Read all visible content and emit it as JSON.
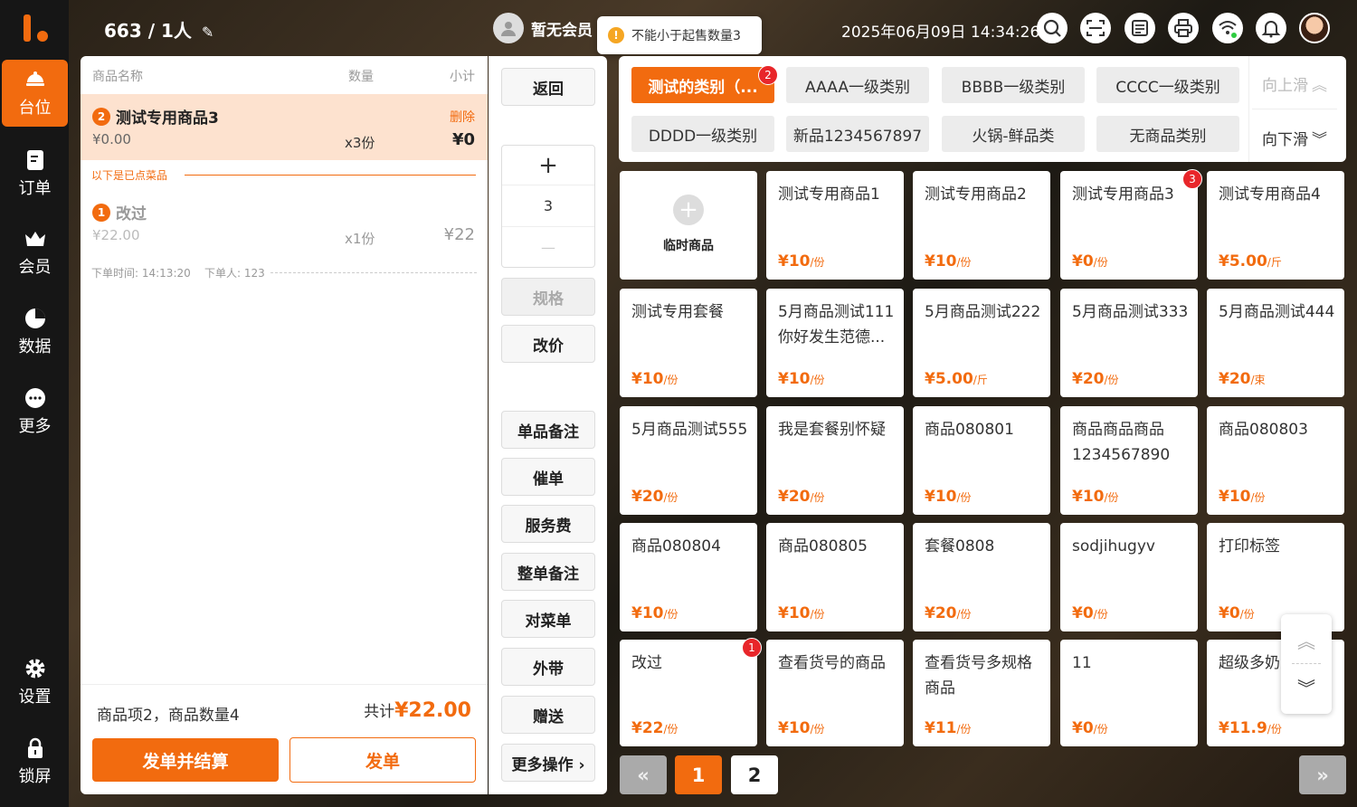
{
  "colors": {
    "accent": "#f26b0f",
    "badge": "#e8262a",
    "sidebar": "#161616"
  },
  "nav": [
    {
      "label": "台位",
      "icon": "dining-table-icon",
      "active": true
    },
    {
      "label": "订单",
      "icon": "order-icon"
    },
    {
      "label": "会员",
      "icon": "member-crown-icon"
    },
    {
      "label": "数据",
      "icon": "pie-chart-icon"
    },
    {
      "label": "更多",
      "icon": "more-dots-icon"
    },
    {
      "label": "设置",
      "icon": "gear-icon"
    },
    {
      "label": "锁屏",
      "icon": "lock-icon"
    }
  ],
  "topbar": {
    "table_info": "663 / 1人",
    "member": "暂无会员",
    "toast": "不能小于起售数量3",
    "datetime": "2025年06月09日 14:34:26",
    "icons": [
      "search-icon",
      "scan-icon",
      "receipt-icon",
      "printer-icon",
      "wifi-icon",
      "bell-icon"
    ]
  },
  "order": {
    "headers": {
      "name": "商品名称",
      "qty": "数量",
      "subtotal": "小计"
    },
    "current": {
      "index": "2",
      "name": "测试专用商品3",
      "delete": "删除",
      "price": "¥0.00",
      "qty": "x3份",
      "subtotal": "¥0"
    },
    "ordered_label": "以下是已点菜品",
    "ordered": {
      "index": "1",
      "name": "改过",
      "price": "¥22.00",
      "qty": "x1份",
      "subtotal": "¥22"
    },
    "meta": "下单时间: 14:13:20    下单人: 123",
    "summary": "商品项2，商品数量4",
    "total_label": "共计",
    "total_value": "¥22.00",
    "settle_btn": "发单并结算",
    "send_btn": "发单"
  },
  "actions": {
    "back": "返回",
    "plus": "+",
    "qty": "3",
    "minus": "—",
    "spec": "规格",
    "change_price": "改价",
    "item_note": "单品备注",
    "urge": "催单",
    "service_fee": "服务费",
    "order_note": "整单备注",
    "check_menu": "对菜单",
    "takeout": "外带",
    "gift": "赠送",
    "more": "更多操作 ›"
  },
  "categories": {
    "items": [
      {
        "label": "测试的类别（...",
        "active": true,
        "badge": "2"
      },
      {
        "label": "AAAA一级类别"
      },
      {
        "label": "BBBB一级类别"
      },
      {
        "label": "CCCC一级类别"
      },
      {
        "label": "DDDD一级类别"
      },
      {
        "label": "新品1234567897"
      },
      {
        "label": "火锅-鲜品类"
      },
      {
        "label": "无商品类别"
      }
    ],
    "scroll_up": "向上滑",
    "scroll_down": "向下滑"
  },
  "temp_product": "临时商品",
  "products": [
    {
      "name": "测试专用商品1",
      "price": "¥10",
      "unit": "/份"
    },
    {
      "name": "测试专用商品2",
      "price": "¥10",
      "unit": "/份"
    },
    {
      "name": "测试专用商品3",
      "price": "¥0",
      "unit": "/份",
      "badge": "3"
    },
    {
      "name": "测试专用商品4",
      "price": "¥5.00",
      "unit": "/斤"
    },
    {
      "name": "测试专用套餐",
      "price": "¥10",
      "unit": "/份"
    },
    {
      "name": "5月商品测试111你好发生范德...",
      "price": "¥10",
      "unit": "/份"
    },
    {
      "name": "5月商品测试222",
      "price": "¥5.00",
      "unit": "/斤"
    },
    {
      "name": "5月商品测试333",
      "price": "¥20",
      "unit": "/份"
    },
    {
      "name": "5月商品测试444",
      "price": "¥20",
      "unit": "/束"
    },
    {
      "name": "5月商品测试555",
      "price": "¥20",
      "unit": "/份"
    },
    {
      "name": "我是套餐别怀疑",
      "price": "¥20",
      "unit": "/份"
    },
    {
      "name": "商品080801",
      "price": "¥10",
      "unit": "/份"
    },
    {
      "name": "商品商品商品1234567890",
      "price": "¥10",
      "unit": "/份"
    },
    {
      "name": "商品080803",
      "price": "¥10",
      "unit": "/份"
    },
    {
      "name": "商品080804",
      "price": "¥10",
      "unit": "/份"
    },
    {
      "name": "商品080805",
      "price": "¥10",
      "unit": "/份"
    },
    {
      "name": "套餐0808",
      "price": "¥20",
      "unit": "/份"
    },
    {
      "name": "sodjihugyv",
      "price": "¥0",
      "unit": "/份"
    },
    {
      "name": "打印标签",
      "price": "¥0",
      "unit": "/份"
    },
    {
      "name": "改过",
      "price": "¥22",
      "unit": "/份",
      "badge": "1"
    },
    {
      "name": "查看货号的商品",
      "price": "¥10",
      "unit": "/份"
    },
    {
      "name": "查看货号多规格商品",
      "price": "¥11",
      "unit": "/份"
    },
    {
      "name": "11",
      "price": "¥0",
      "unit": "/份"
    },
    {
      "name": "超级多奶",
      "price": "¥11.9",
      "unit": "/份"
    }
  ],
  "pager": {
    "prev": "«",
    "pages": [
      "1",
      "2"
    ],
    "current": "1",
    "next": "»"
  }
}
